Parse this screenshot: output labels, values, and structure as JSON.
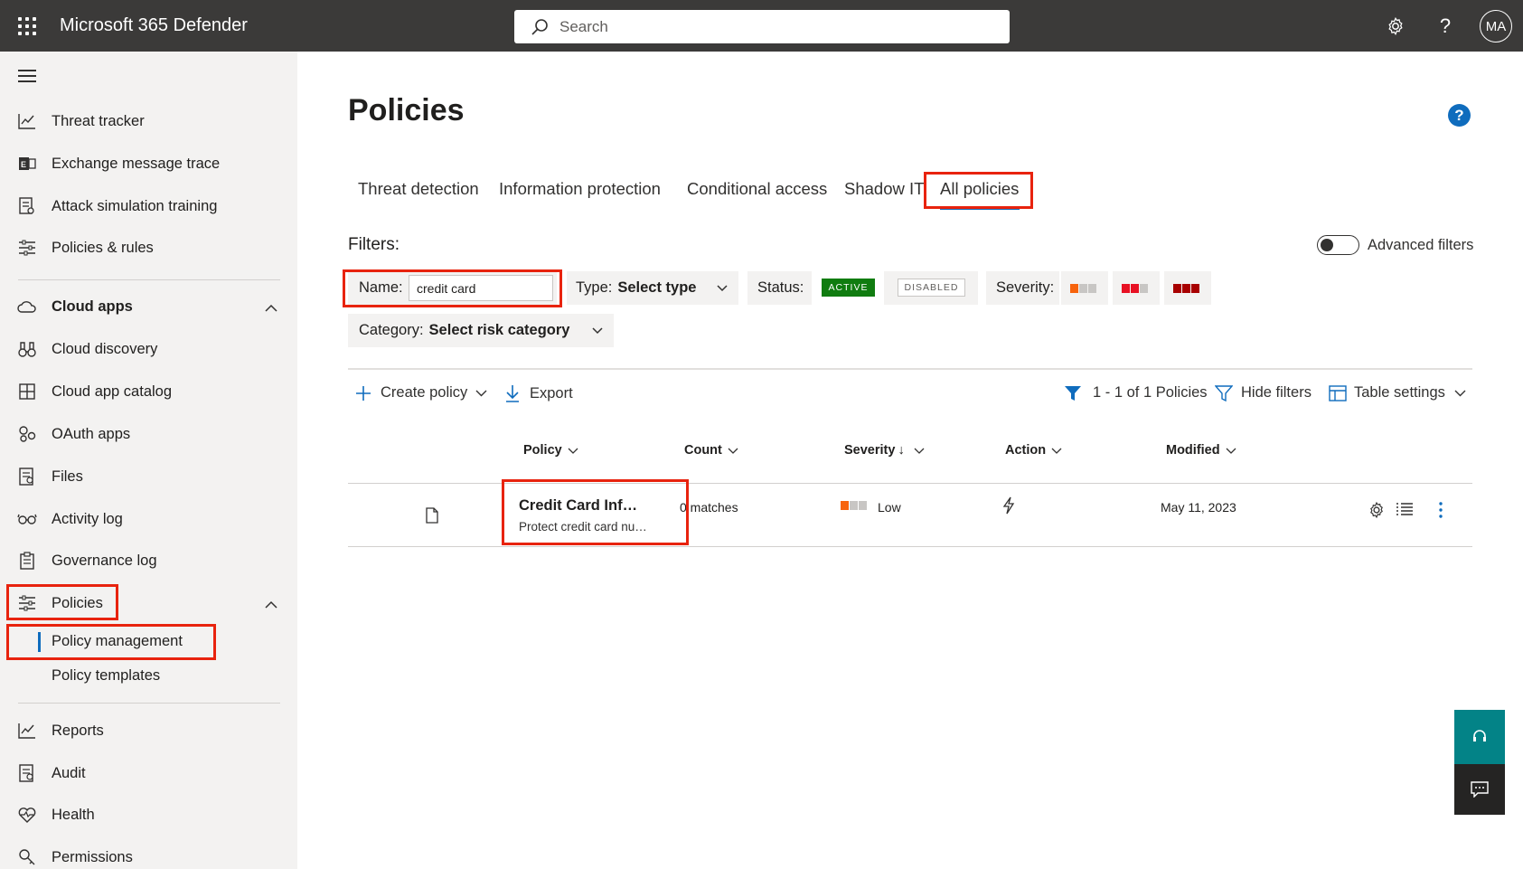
{
  "header": {
    "app_title": "Microsoft 365 Defender",
    "search_placeholder": "Search",
    "avatar_initials": "MA"
  },
  "sidebar": {
    "items": [
      {
        "label": "Threat tracker",
        "icon": "chart-line-icon"
      },
      {
        "label": "Exchange message trace",
        "icon": "exchange-icon"
      },
      {
        "label": "Attack simulation training",
        "icon": "simulation-icon"
      },
      {
        "label": "Policies & rules",
        "icon": "sliders-icon"
      }
    ],
    "cloud_apps": {
      "label": "Cloud apps",
      "items": [
        {
          "label": "Cloud discovery",
          "icon": "binoculars-icon"
        },
        {
          "label": "Cloud app catalog",
          "icon": "grid-icon"
        },
        {
          "label": "OAuth apps",
          "icon": "oauth-icon"
        },
        {
          "label": "Files",
          "icon": "files-icon"
        },
        {
          "label": "Activity log",
          "icon": "glasses-icon"
        },
        {
          "label": "Governance log",
          "icon": "clipboard-icon"
        }
      ]
    },
    "policies": {
      "label": "Policies",
      "sub_items": [
        "Policy management",
        "Policy templates"
      ]
    },
    "bottom_items": [
      {
        "label": "Reports",
        "icon": "chart-line-icon"
      },
      {
        "label": "Audit",
        "icon": "audit-icon"
      },
      {
        "label": "Health",
        "icon": "heart-icon"
      },
      {
        "label": "Permissions",
        "icon": "key-icon"
      }
    ]
  },
  "main": {
    "title": "Policies",
    "tabs": [
      "Threat detection",
      "Information protection",
      "Conditional access",
      "Shadow IT",
      "All policies"
    ],
    "selected_tab": "All policies",
    "filters_label": "Filters:",
    "advanced_filters_label": "Advanced filters",
    "name_filter": {
      "label": "Name:",
      "value": "credit card"
    },
    "type_filter": {
      "label": "Type:",
      "value": "Select type"
    },
    "status_filter": {
      "label": "Status:",
      "active": "ACTIVE",
      "disabled": "DISABLED"
    },
    "severity_filter": {
      "label": "Severity:"
    },
    "category_filter": {
      "label": "Category:",
      "value": "Select risk category"
    },
    "commands": {
      "create_policy": "Create policy",
      "export": "Export",
      "results_count": "1 - 1 of 1 Policies",
      "hide_filters": "Hide filters",
      "table_settings": "Table settings"
    },
    "table": {
      "columns": [
        "Policy",
        "Count",
        "Severity",
        "Action",
        "Modified"
      ],
      "rows": [
        {
          "policy_name": "Credit Card Inf…",
          "policy_description": "Protect credit card nu…",
          "count": "0 matches",
          "severity": "Low",
          "modified": "May 11, 2023"
        }
      ]
    }
  },
  "colors": {
    "topbar": "#3b3a39",
    "sidebar": "#f3f2f1",
    "accent": "#0f6cbd",
    "highlight_box": "#e8230e",
    "active_status": "#107c10",
    "floating_help": "#038387",
    "floating_chat": "#252423"
  }
}
